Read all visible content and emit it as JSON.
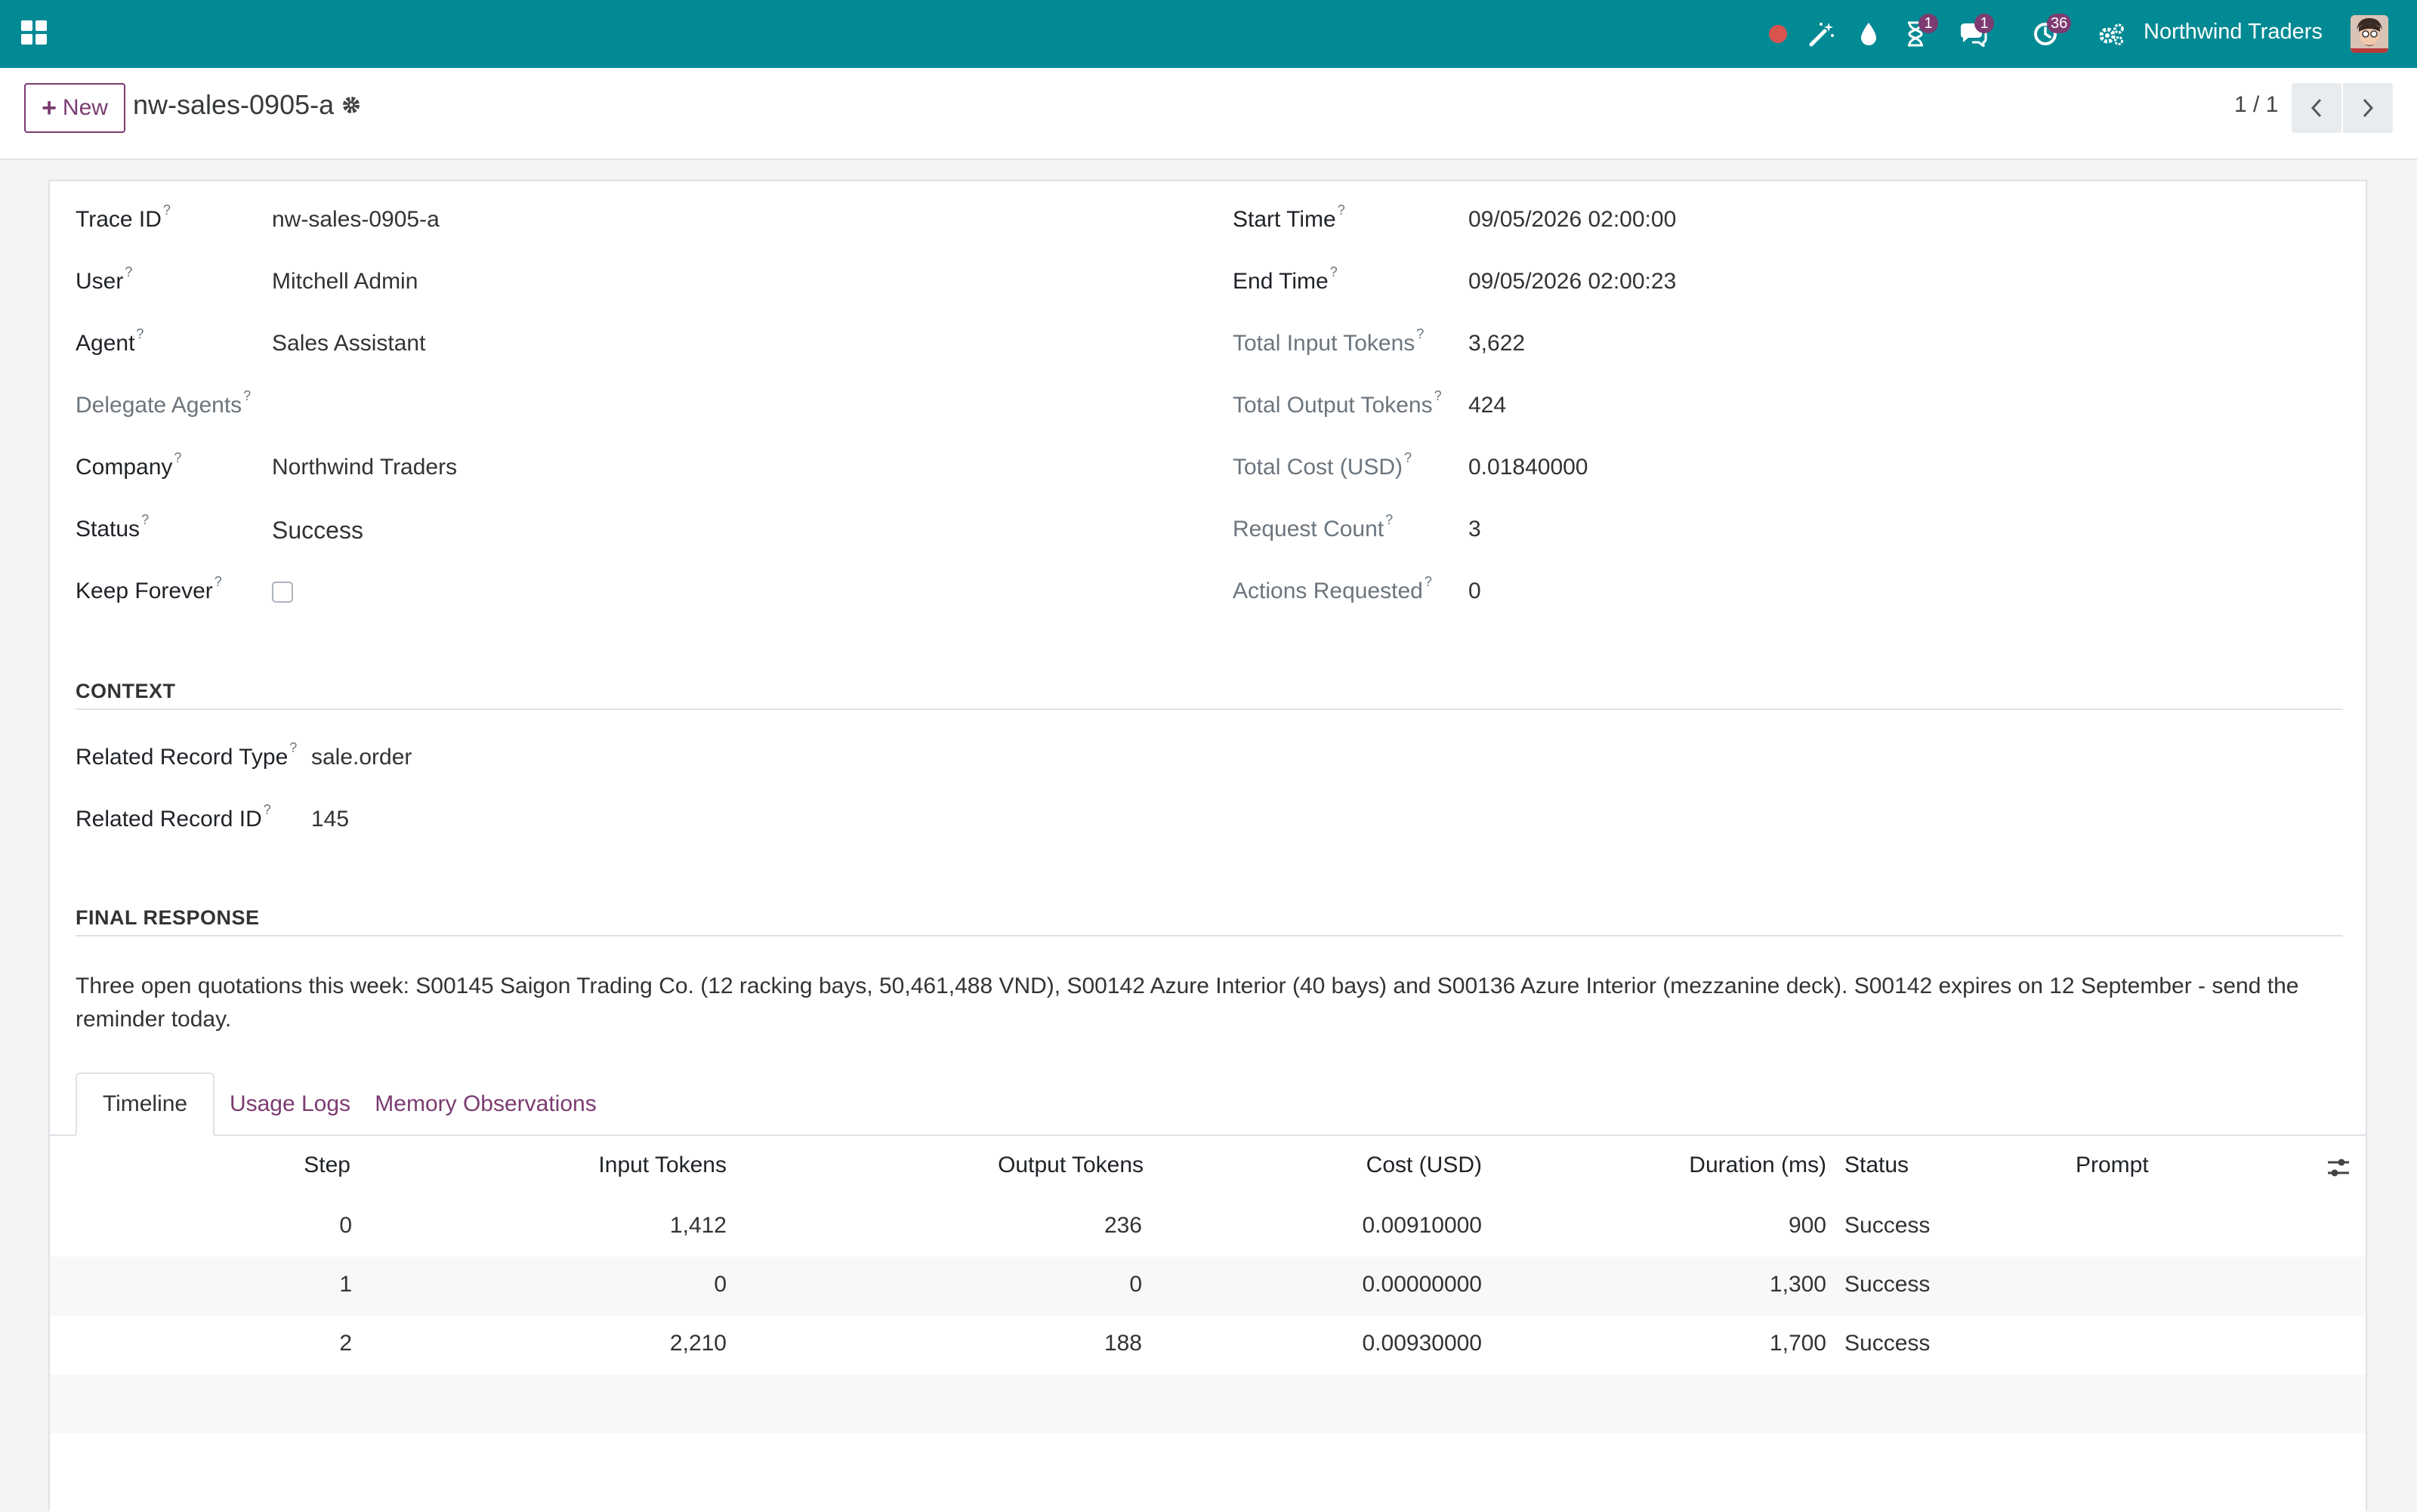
{
  "navbar": {
    "company": "Northwind Traders",
    "icons": [
      "apps-grid-icon",
      "record-dot-icon",
      "magic-wand-icon",
      "droplet-icon",
      "hourglass-icon",
      "chat-icon",
      "clock-icon",
      "settings-gears-icon"
    ],
    "badges": {
      "activities": "1",
      "messages": "1",
      "clock": "36"
    },
    "colors": {
      "navbar": "#028a94",
      "badge": "#7c3b71",
      "record": "#d9534f"
    }
  },
  "control_panel": {
    "new_label": "New",
    "title": "nw-sales-0905-a",
    "pager": "1 / 1"
  },
  "fields_left": [
    {
      "label": "Trace ID",
      "value": "nw-sales-0905-a"
    },
    {
      "label": "User",
      "value": "Mitchell Admin"
    },
    {
      "label": "Agent",
      "value": "Sales Assistant"
    },
    {
      "label": "Delegate Agents",
      "value": ""
    },
    {
      "label": "Company",
      "value": "Northwind Traders"
    },
    {
      "label": "Status",
      "value": "Success"
    },
    {
      "label": "Keep Forever",
      "value": ""
    }
  ],
  "fields_right": [
    {
      "label": "Start Time",
      "value": "09/05/2026 02:00:00"
    },
    {
      "label": "End Time",
      "value": "09/05/2026 02:00:23"
    },
    {
      "label": "Total Input Tokens",
      "value": "3,622"
    },
    {
      "label": "Total Output Tokens",
      "value": "424"
    },
    {
      "label": "Total Cost (USD)",
      "value": "0.01840000"
    },
    {
      "label": "Request Count",
      "value": "3"
    },
    {
      "label": "Actions Requested",
      "value": "0"
    }
  ],
  "help_marker": "?",
  "context": {
    "title": "CONTEXT",
    "fields": [
      {
        "label": "Related Record Type",
        "value": "sale.order"
      },
      {
        "label": "Related Record ID",
        "value": "145"
      }
    ]
  },
  "final_response": {
    "title": "FINAL RESPONSE",
    "text": "Three open quotations this week: S00145 Saigon Trading Co. (12 racking bays, 50,461,488 VND), S00142 Azure Interior (40 bays) and S00136 Azure Interior (mezzanine deck). S00142 expires on 12 September - send the reminder today."
  },
  "tabs": [
    "Timeline",
    "Usage Logs",
    "Memory Observations"
  ],
  "table": {
    "columns": [
      "Step",
      "Input Tokens",
      "Output Tokens",
      "Cost (USD)",
      "Duration (ms)",
      "Status",
      "Prompt"
    ],
    "rows": [
      {
        "step": "0",
        "input": "1,412",
        "output": "236",
        "cost": "0.00910000",
        "duration": "900",
        "status": "Success",
        "prompt": ""
      },
      {
        "step": "1",
        "input": "0",
        "output": "0",
        "cost": "0.00000000",
        "duration": "1,300",
        "status": "Success",
        "prompt": ""
      },
      {
        "step": "2",
        "input": "2,210",
        "output": "188",
        "cost": "0.00930000",
        "duration": "1,700",
        "status": "Success",
        "prompt": ""
      }
    ]
  }
}
